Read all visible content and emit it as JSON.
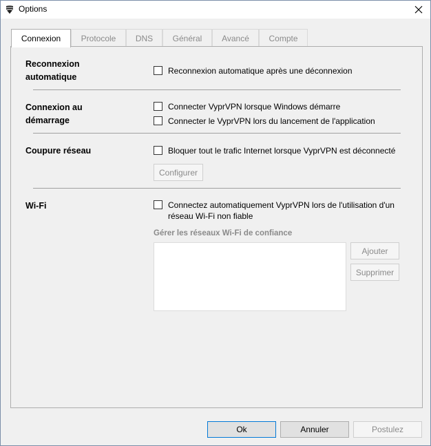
{
  "window": {
    "title": "Options",
    "close_glyph": "✕"
  },
  "tabs": [
    {
      "label": "Connexion",
      "active": true
    },
    {
      "label": "Protocole",
      "active": false
    },
    {
      "label": "DNS",
      "active": false
    },
    {
      "label": "Général",
      "active": false
    },
    {
      "label": "Avancé",
      "active": false
    },
    {
      "label": "Compte",
      "active": false
    }
  ],
  "sections": {
    "reconnect": {
      "title_line1": "Reconnexion",
      "title_line2": "automatique",
      "option1": "Reconnexion automatique après une déconnexion"
    },
    "startup": {
      "title_line1": "Connexion au",
      "title_line2": "démarrage",
      "option1": "Connecter VyprVPN lorsque Windows démarre",
      "option2": "Connecter le VyprVPN lors du lancement de l'application"
    },
    "killswitch": {
      "title": "Coupure réseau",
      "option1": "Bloquer tout le trafic Internet lorsque VyprVPN est déconnecté",
      "configure_label": "Configurer"
    },
    "wifi": {
      "title": "Wi-Fi",
      "option1_line1": "Connectez automatiquement VyprVPN lors de l'utilisation d'un",
      "option1_line2": "réseau Wi-Fi non fiable",
      "trusted_label": "Gérer les réseaux Wi-Fi de confiance",
      "add_label": "Ajouter",
      "remove_label": "Supprimer"
    }
  },
  "footer": {
    "ok_label": "Ok",
    "cancel_label": "Annuler",
    "apply_label": "Postulez"
  }
}
